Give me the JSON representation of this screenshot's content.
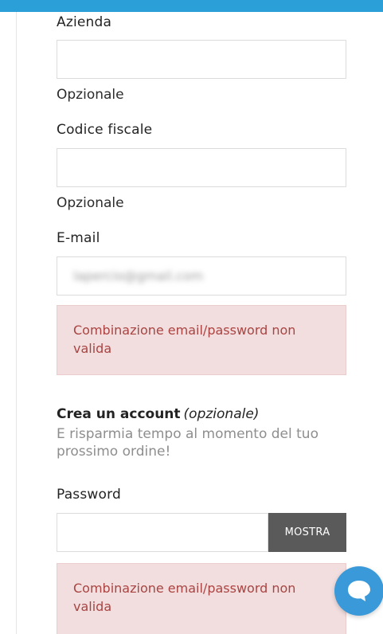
{
  "colors": {
    "topbar": "#2a9fd8",
    "error_bg": "#f2dede",
    "error_text": "#a94442",
    "button_bg": "#5a5a5a",
    "chat_bg": "#3a9ad9"
  },
  "fields": {
    "company": {
      "label": "Azienda",
      "value": "",
      "helper": "Opzionale"
    },
    "tax_code": {
      "label": "Codice fiscale",
      "value": "",
      "helper": "Opzionale"
    },
    "email": {
      "label": "E-mail",
      "value": "lapercio@gmail.com",
      "error": "Combinazione email/password non valida"
    }
  },
  "account": {
    "title": "Crea un account",
    "title_suffix": "(opzionale)",
    "subtitle": "E risparmia tempo al momento del tuo prossimo ordine!"
  },
  "password": {
    "label": "Password",
    "value": "",
    "show_button": "MOSTRA",
    "error": "Combinazione email/password non valida"
  },
  "chat": {
    "icon": "chat-bubble-icon"
  }
}
